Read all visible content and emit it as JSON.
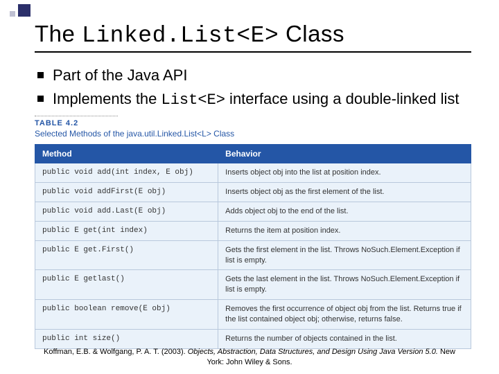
{
  "title_pre": "The ",
  "title_code": "Linked.List<E>",
  "title_post": " Class",
  "bullets": [
    {
      "pre": "Part of the Java API",
      "code": "",
      "post": ""
    },
    {
      "pre": "Implements the ",
      "code": "List<E>",
      "post": " interface using a double-linked list"
    }
  ],
  "table_label": "TABLE 4.2",
  "table_caption": "Selected Methods of the java.util.Linked.List<L> Class",
  "columns": [
    "Method",
    "Behavior"
  ],
  "rows": [
    {
      "m": "public void add(int index, E obj)",
      "b": "Inserts object obj into the list at position index."
    },
    {
      "m": "public void addFirst(E obj)",
      "b": "Inserts object obj as the first element of the list."
    },
    {
      "m": "public void add.Last(E obj)",
      "b": "Adds object obj to the end of the list."
    },
    {
      "m": "public E get(int index)",
      "b": "Returns the item at position index."
    },
    {
      "m": "public E get.First()",
      "b": "Gets the first element in the list. Throws NoSuch.Element.Exception if list is empty."
    },
    {
      "m": "public E getlast()",
      "b": "Gets the last element in the list. Throws NoSuch.Element.Exception if list is empty."
    },
    {
      "m": "public boolean remove(E obj)",
      "b": "Removes the first occurrence of object obj from the list. Returns true if the list contained object obj; otherwise, returns false."
    },
    {
      "m": "public int size()",
      "b": "Returns the number of objects contained in the list."
    }
  ],
  "citation_pre": "Koffman, E.B. & Wolfgang, P. A. T. (2003). ",
  "citation_ital": "Objects, Abstraction, Data Structures, and Design Using Java Version 5.0.",
  "citation_post": " New York: John Wiley & Sons."
}
